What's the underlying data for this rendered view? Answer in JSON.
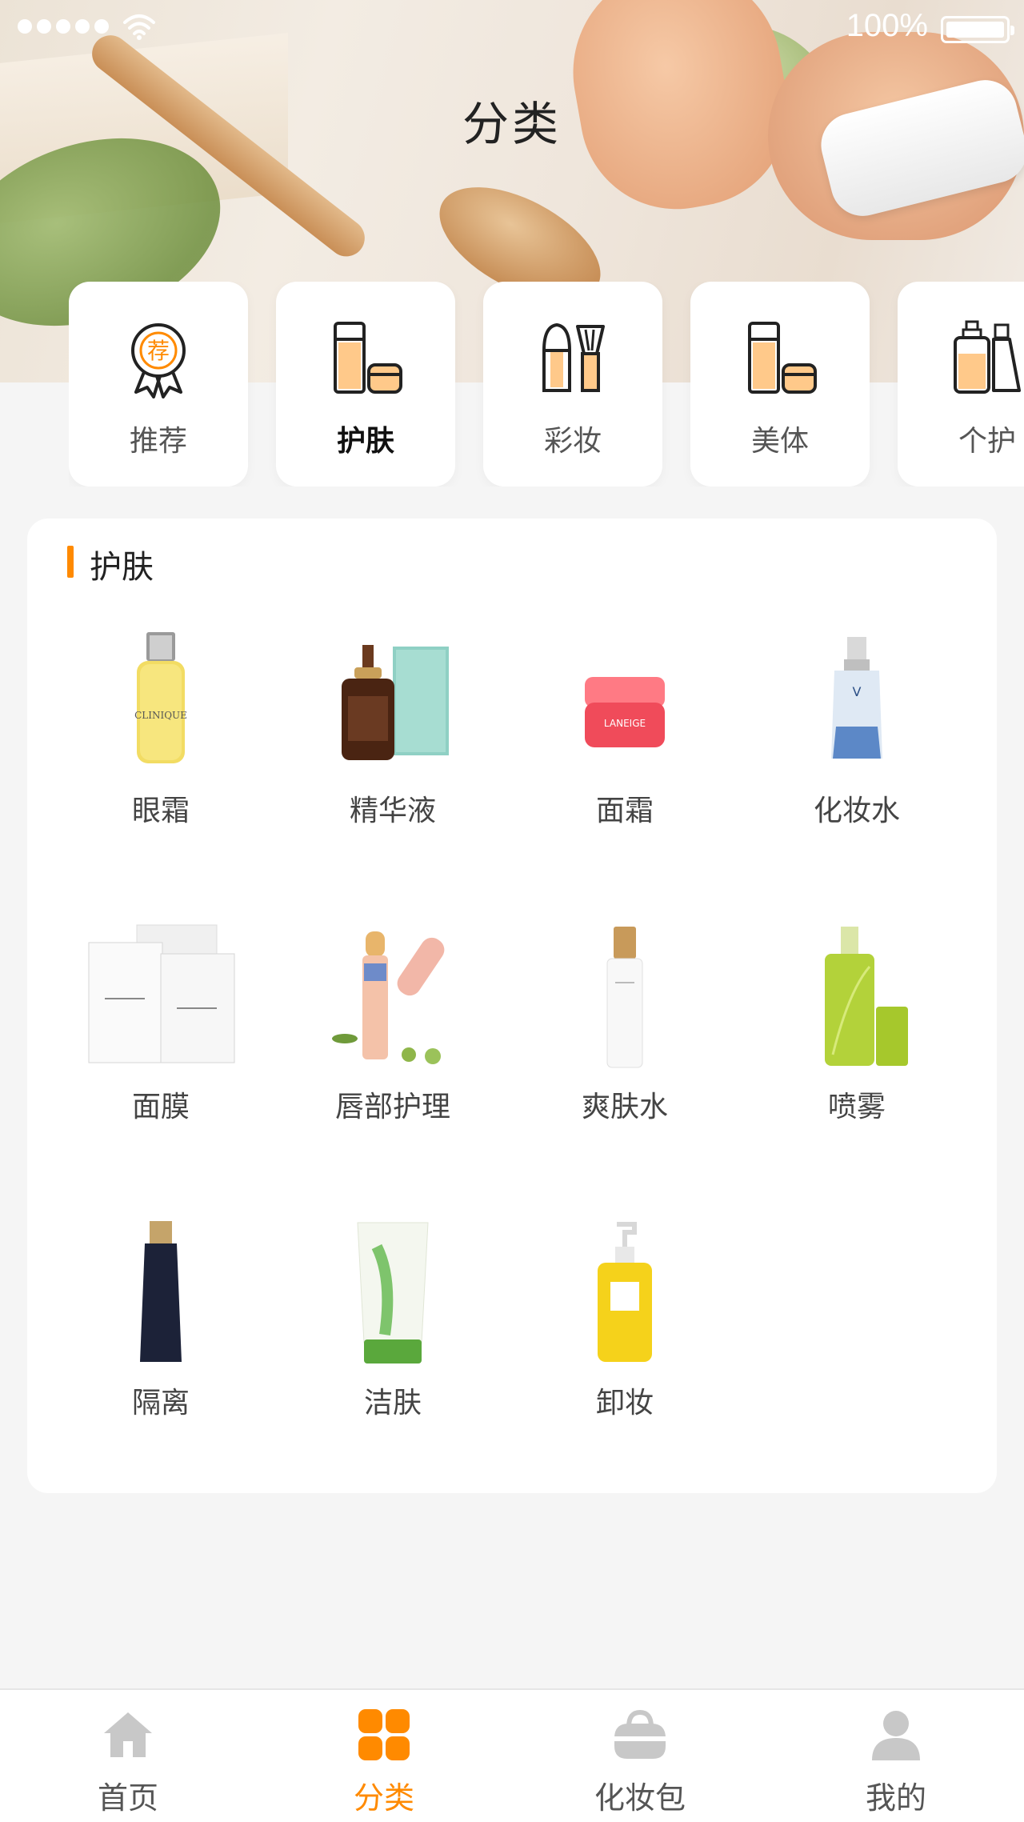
{
  "status_bar": {
    "battery": "100%"
  },
  "header": {
    "title": "分类"
  },
  "categories": [
    {
      "label": "推荐",
      "icon": "recommend-badge-icon",
      "badge_char": "荐",
      "active": false
    },
    {
      "label": "护肤",
      "icon": "skincare-icon",
      "active": true
    },
    {
      "label": "彩妆",
      "icon": "makeup-icon",
      "active": false
    },
    {
      "label": "美体",
      "icon": "body-care-icon",
      "active": false
    },
    {
      "label": "个护",
      "icon": "personal-care-icon",
      "active": false
    }
  ],
  "panel": {
    "title": "护肤",
    "items": [
      {
        "label": "眼霜",
        "icon": "eye-cream-bottle-image"
      },
      {
        "label": "精华液",
        "icon": "serum-bottle-image"
      },
      {
        "label": "面霜",
        "icon": "face-cream-jar-image"
      },
      {
        "label": "化妆水",
        "icon": "toner-bottle-image"
      },
      {
        "label": "面膜",
        "icon": "face-mask-pack-image"
      },
      {
        "label": "唇部护理",
        "icon": "lip-balm-image"
      },
      {
        "label": "爽肤水",
        "icon": "lotion-bottle-image"
      },
      {
        "label": "喷雾",
        "icon": "spray-bottle-image"
      },
      {
        "label": "隔离",
        "icon": "primer-tube-image"
      },
      {
        "label": "洁肤",
        "icon": "cleanser-tube-image"
      },
      {
        "label": "卸妆",
        "icon": "cleansing-oil-image"
      }
    ]
  },
  "tab_bar": [
    {
      "label": "首页",
      "icon": "home-icon",
      "active": false
    },
    {
      "label": "分类",
      "icon": "category-grid-icon",
      "active": true
    },
    {
      "label": "化妆包",
      "icon": "makeup-bag-icon",
      "active": false
    },
    {
      "label": "我的",
      "icon": "profile-icon",
      "active": false
    }
  ],
  "colors": {
    "accent": "#ff8a00",
    "background": "#f5f5f5",
    "card": "#ffffff",
    "icon_gray": "#c8c8c8"
  }
}
